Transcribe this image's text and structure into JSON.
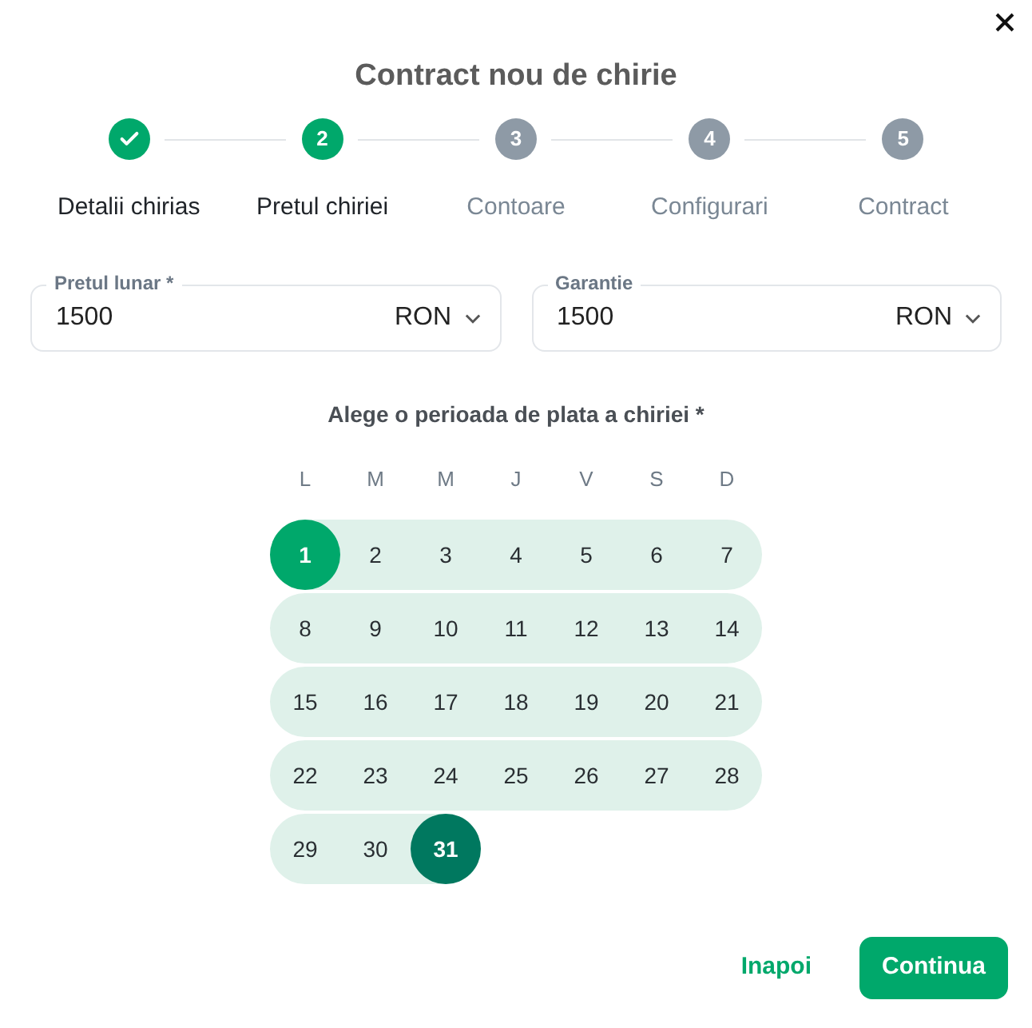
{
  "title": "Contract nou de chirie",
  "steps": [
    {
      "label": "Detalii chirias",
      "completed": true,
      "selected": false
    },
    {
      "number": "2",
      "label": "Pretul chiriei",
      "completed": false,
      "selected": true
    },
    {
      "number": "3",
      "label": "Contoare",
      "completed": false,
      "selected": false
    },
    {
      "number": "4",
      "label": "Configurari",
      "completed": false,
      "selected": false
    },
    {
      "number": "5",
      "label": "Contract",
      "completed": false,
      "selected": false
    }
  ],
  "fields": [
    {
      "label": "Pretul lunar *",
      "value": "1500",
      "currency": "RON"
    },
    {
      "label": "Garantie",
      "value": "1500",
      "currency": "RON"
    }
  ],
  "calendar": {
    "heading": "Alege o perioada de plata a chiriei *",
    "weekdays": [
      "L",
      "M",
      "M",
      "J",
      "V",
      "S",
      "D"
    ],
    "weeks": [
      [
        {
          "day": "1",
          "kind": "start"
        },
        {
          "day": "2",
          "kind": "range"
        },
        {
          "day": "3",
          "kind": "range"
        },
        {
          "day": "4",
          "kind": "range"
        },
        {
          "day": "5",
          "kind": "range"
        },
        {
          "day": "6",
          "kind": "range"
        },
        {
          "day": "7",
          "kind": "range"
        }
      ],
      [
        {
          "day": "8",
          "kind": "range"
        },
        {
          "day": "9",
          "kind": "range"
        },
        {
          "day": "10",
          "kind": "range"
        },
        {
          "day": "11",
          "kind": "range"
        },
        {
          "day": "12",
          "kind": "range"
        },
        {
          "day": "13",
          "kind": "range"
        },
        {
          "day": "14",
          "kind": "range"
        }
      ],
      [
        {
          "day": "15",
          "kind": "range"
        },
        {
          "day": "16",
          "kind": "range"
        },
        {
          "day": "17",
          "kind": "range"
        },
        {
          "day": "18",
          "kind": "range"
        },
        {
          "day": "19",
          "kind": "range"
        },
        {
          "day": "20",
          "kind": "range"
        },
        {
          "day": "21",
          "kind": "range"
        }
      ],
      [
        {
          "day": "22",
          "kind": "range"
        },
        {
          "day": "23",
          "kind": "range"
        },
        {
          "day": "24",
          "kind": "range"
        },
        {
          "day": "25",
          "kind": "range"
        },
        {
          "day": "26",
          "kind": "range"
        },
        {
          "day": "27",
          "kind": "range"
        },
        {
          "day": "28",
          "kind": "range"
        }
      ],
      [
        {
          "day": "29",
          "kind": "range"
        },
        {
          "day": "30",
          "kind": "range"
        },
        {
          "day": "31",
          "kind": "end"
        }
      ]
    ]
  },
  "buttons": {
    "back": "Inapoi",
    "next": "Continua"
  }
}
